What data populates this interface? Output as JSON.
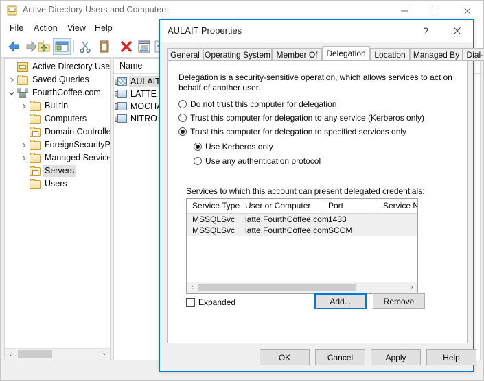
{
  "main_window": {
    "title": "Active Directory Users and Computers",
    "title_icon": "console-book-icon",
    "window_buttons": {
      "minimize": "minimize-icon",
      "maximize": "maximize-icon",
      "close": "close-icon"
    },
    "menu": [
      {
        "label": "File"
      },
      {
        "label": "Action"
      },
      {
        "label": "View"
      },
      {
        "label": "Help"
      }
    ],
    "toolbar": [
      {
        "name": "back-icon",
        "glyph": "back"
      },
      {
        "name": "forward-icon",
        "glyph": "forward"
      },
      {
        "name": "up-folder-icon",
        "glyph": "upfolder"
      },
      {
        "name": "show-hide-console-tree-icon",
        "glyph": "console"
      },
      {
        "name": "cut-icon",
        "glyph": "cut"
      },
      {
        "name": "copy-icon",
        "glyph": "copy"
      },
      {
        "name": "delete-icon",
        "glyph": "delete"
      },
      {
        "name": "properties-icon",
        "glyph": "properties"
      },
      {
        "name": "refresh-icon",
        "glyph": "refresh"
      }
    ],
    "tree": {
      "items": [
        {
          "label": "Active Directory Users an",
          "icon": "console-book-icon",
          "indent": 0,
          "chevron": "none",
          "selected": false
        },
        {
          "label": "Saved Queries",
          "icon": "folder-icon",
          "indent": 1,
          "chevron": "collapsed",
          "selected": false
        },
        {
          "label": "FourthCoffee.com",
          "icon": "domain-icon",
          "indent": 1,
          "chevron": "expanded",
          "selected": false
        },
        {
          "label": "Builtin",
          "icon": "folder-icon",
          "indent": 2,
          "chevron": "collapsed",
          "selected": false
        },
        {
          "label": "Computers",
          "icon": "folder-icon",
          "indent": 2,
          "chevron": "none",
          "selected": false
        },
        {
          "label": "Domain Controlle",
          "icon": "ou-folder-icon",
          "indent": 2,
          "chevron": "none",
          "selected": false
        },
        {
          "label": "ForeignSecurityPr",
          "icon": "folder-icon",
          "indent": 2,
          "chevron": "collapsed",
          "selected": false
        },
        {
          "label": "Managed Service",
          "icon": "folder-icon",
          "indent": 2,
          "chevron": "collapsed",
          "selected": false
        },
        {
          "label": "Servers",
          "icon": "ou-folder-icon",
          "indent": 2,
          "chevron": "none",
          "selected": true
        },
        {
          "label": "Users",
          "icon": "folder-icon",
          "indent": 2,
          "chevron": "none",
          "selected": false
        }
      ],
      "hscrollbar": {
        "left_arrow": "‹",
        "right_arrow": "›"
      }
    },
    "list": {
      "column_header": "Name",
      "items": [
        {
          "label": "AULAIT",
          "icon": "computer-icon-selected",
          "selected": true
        },
        {
          "label": "LATTE",
          "icon": "computer-icon",
          "selected": false
        },
        {
          "label": "MOCHA",
          "icon": "computer-icon",
          "selected": false
        },
        {
          "label": "NITRO",
          "icon": "computer-icon",
          "selected": false
        }
      ]
    }
  },
  "dialog": {
    "title": "AULAIT Properties",
    "help_button": "?",
    "close_button": "close-icon",
    "tabs": [
      {
        "label": "General",
        "active": false
      },
      {
        "label": "Operating System",
        "active": false
      },
      {
        "label": "Member Of",
        "active": false
      },
      {
        "label": "Delegation",
        "active": true
      },
      {
        "label": "Location",
        "active": false
      },
      {
        "label": "Managed By",
        "active": false
      },
      {
        "label": "Dial-in",
        "active": false
      }
    ],
    "delegation": {
      "description": "Delegation is a security-sensitive operation, which allows services to act on behalf of another user.",
      "options": [
        {
          "label": "Do not trust this computer for delegation",
          "selected": false
        },
        {
          "label": "Trust this computer for delegation to any service (Kerberos only)",
          "selected": false
        },
        {
          "label": "Trust this computer for delegation to specified services only",
          "selected": true
        }
      ],
      "sub_options": [
        {
          "label": "Use Kerberos only",
          "selected": true
        },
        {
          "label": "Use any authentication protocol",
          "selected": false
        }
      ],
      "services_label": "Services to which this account can present delegated credentials:",
      "table": {
        "columns": [
          "Service Type",
          "User or Computer",
          "Port",
          "Service Na"
        ],
        "rows": [
          [
            "MSSQLSvc",
            "latte.FourthCoffee.com",
            "1433",
            ""
          ],
          [
            "MSSQLSvc",
            "latte.FourthCoffee.com",
            "SCCM",
            ""
          ]
        ],
        "hscrollbar": {
          "left_arrow": "‹",
          "right_arrow": "›"
        }
      },
      "expanded_checkbox": {
        "label": "Expanded",
        "checked": false
      },
      "add_button": "Add...",
      "remove_button": "Remove"
    },
    "footer_buttons": {
      "ok": "OK",
      "cancel": "Cancel",
      "apply": "Apply",
      "help": "Help"
    }
  },
  "colors": {
    "accent": "#0078d7",
    "dialog_border": "#0078d7",
    "window_bg": "#f0f0f0",
    "row_bg": "#f0f0f0"
  }
}
